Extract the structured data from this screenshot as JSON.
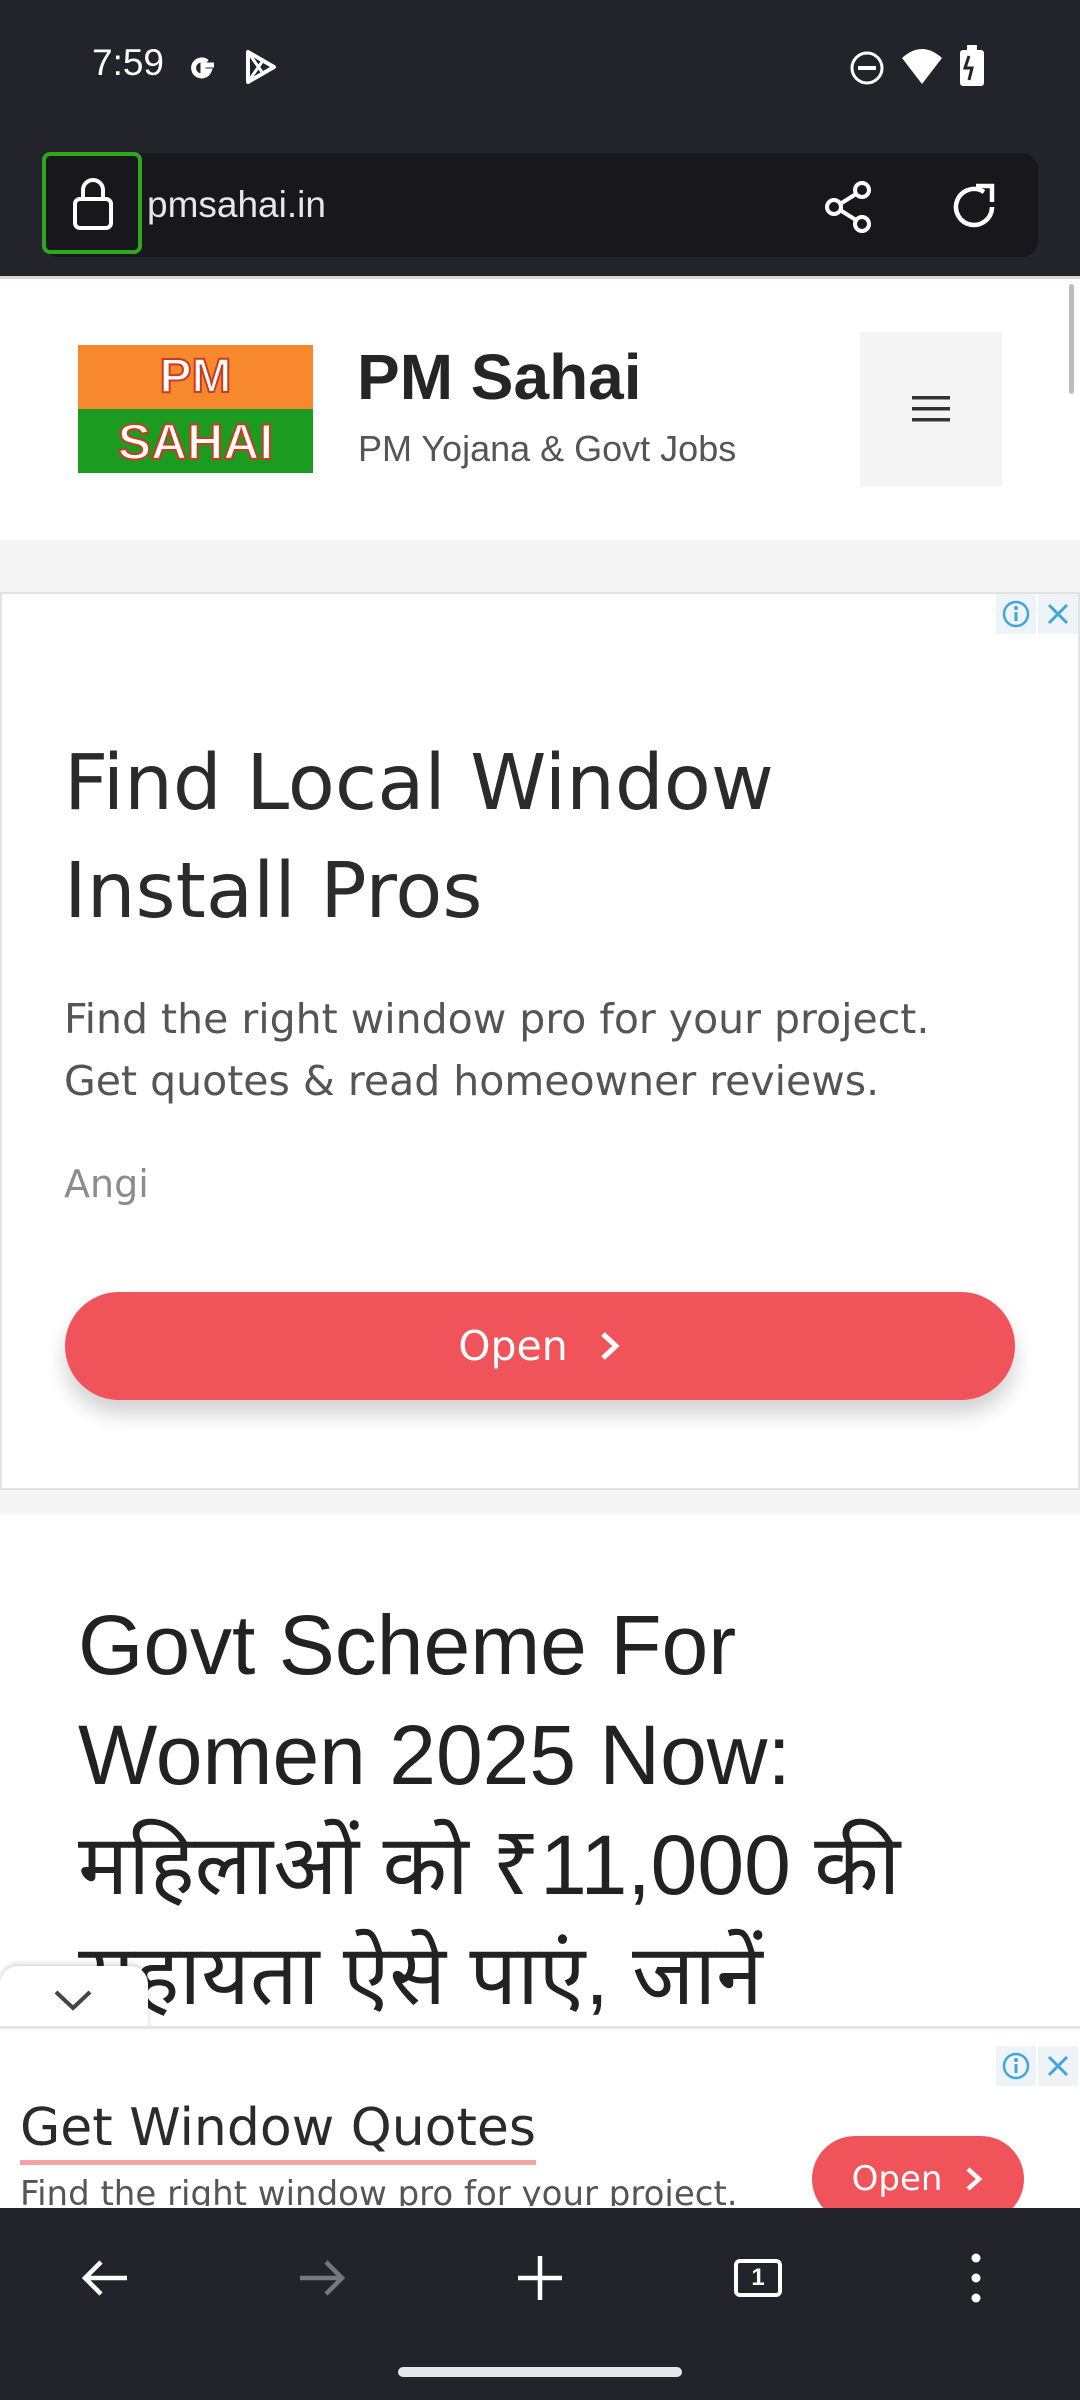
{
  "status_bar": {
    "time": "7:59"
  },
  "url_bar": {
    "url": "pmsahai.in"
  },
  "site": {
    "logo_top": "PM",
    "logo_bottom": "SAHAI",
    "title": "PM Sahai",
    "tagline": "PM Yojana & Govt Jobs"
  },
  "ad1": {
    "headline": "Find Local Window Install Pros",
    "description": "Find the right window pro for your project. Get quotes & read homeowner reviews.",
    "advertiser": "Angi",
    "button": "Open"
  },
  "article": {
    "title": "Govt Scheme For Women 2025 Now: महिलाओं को ₹11,000 की सहायता ऐसे पाएं, जानें"
  },
  "ad2": {
    "headline": "Get Window Quotes",
    "description": "Find the right window pro for your project.",
    "button": "Open"
  },
  "tabs": {
    "count": "1"
  },
  "colors": {
    "chrome_bg": "#23232b",
    "ad_button": "#f0545a",
    "highlight": "#2fa71b",
    "logo_orange": "#f7882d",
    "logo_green": "#1c9b21"
  }
}
